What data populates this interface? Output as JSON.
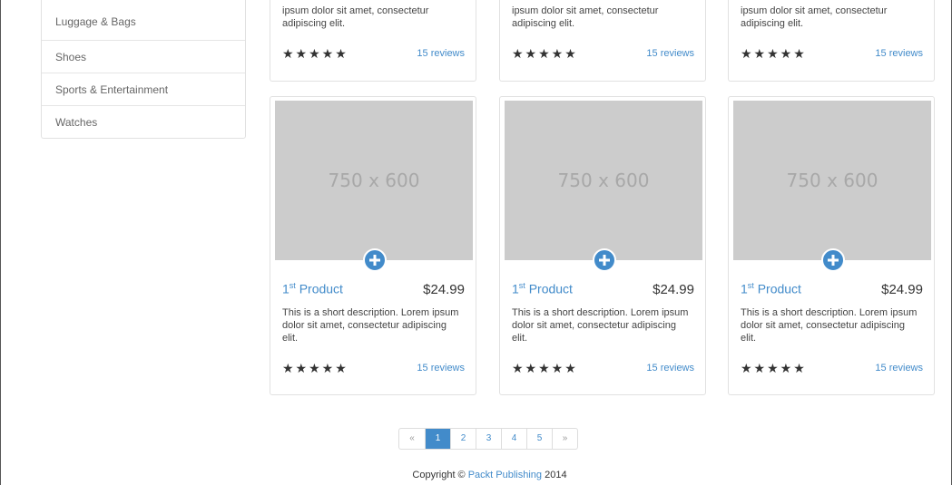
{
  "sidebar": {
    "items": [
      {
        "label": "Luggage & Bags"
      },
      {
        "label": "Shoes"
      },
      {
        "label": "Sports & Entertainment"
      },
      {
        "label": "Watches"
      }
    ]
  },
  "top_cards": [
    {
      "desc": "ipsum dolor sit amet, consectetur adipiscing elit.",
      "stars": "★★★★★",
      "reviews": "15 reviews"
    },
    {
      "desc": "ipsum dolor sit amet, consectetur adipiscing elit.",
      "stars": "★★★★★",
      "reviews": "15 reviews"
    },
    {
      "desc": "ipsum dolor sit amet, consectetur adipiscing elit.",
      "stars": "★★★★★",
      "reviews": "15 reviews"
    }
  ],
  "products": [
    {
      "thumb": "750 x 600",
      "name_num": "1",
      "name_sup": "st",
      "name": " Product",
      "price": "$24.99",
      "desc": "This is a short description. Lorem ipsum dolor sit amet, consectetur adipiscing elit.",
      "stars": "★★★★★",
      "reviews": "15 reviews"
    },
    {
      "thumb": "750 x 600",
      "name_num": "1",
      "name_sup": "st",
      "name": " Product",
      "price": "$24.99",
      "desc": "This is a short description. Lorem ipsum dolor sit amet, consectetur adipiscing elit.",
      "stars": "★★★★★",
      "reviews": "15 reviews"
    },
    {
      "thumb": "750 x 600",
      "name_num": "1",
      "name_sup": "st",
      "name": " Product",
      "price": "$24.99",
      "desc": "This is a short description. Lorem ipsum dolor sit amet, consectetur adipiscing elit.",
      "stars": "★★★★★",
      "reviews": "15 reviews"
    }
  ],
  "icons": {
    "add": "plus-circle-icon"
  },
  "pagination": {
    "prev": "«",
    "pages": [
      "1",
      "2",
      "3",
      "4",
      "5"
    ],
    "active": "1",
    "next": "»"
  },
  "footer": {
    "prefix": "Copyright © ",
    "link": "Packt Publishing",
    "suffix": " 2014"
  },
  "colors": {
    "accent": "#428bca",
    "placeholder": "#cccccc"
  }
}
